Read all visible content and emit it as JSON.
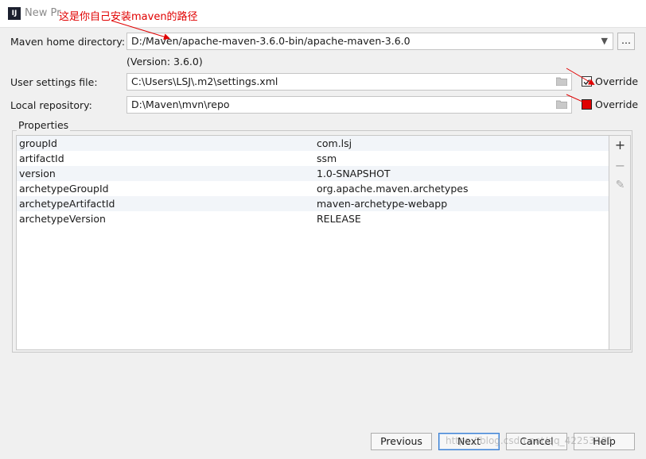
{
  "window": {
    "title": "New Pr",
    "app_icon": "IJ"
  },
  "annotation": "这是你自己安装maven的路径",
  "maven_home": {
    "label": "Maven home directory:",
    "value": "D:/Maven/apache-maven-3.6.0-bin/apache-maven-3.6.0",
    "browse_label": "...",
    "version": "(Version: 3.6.0)"
  },
  "user_settings": {
    "label": "User settings file:",
    "value": "C:\\Users\\LSJ\\.m2\\settings.xml",
    "override_label": "Override"
  },
  "local_repo": {
    "label": "Local repository:",
    "value": "D:\\Maven\\mvn\\repo",
    "override_label": "Override"
  },
  "properties": {
    "legend": "Properties",
    "rows": [
      {
        "key": "groupId",
        "value": "com.lsj"
      },
      {
        "key": "artifactId",
        "value": "ssm"
      },
      {
        "key": "version",
        "value": "1.0-SNAPSHOT"
      },
      {
        "key": "archetypeGroupId",
        "value": "org.apache.maven.archetypes"
      },
      {
        "key": "archetypeArtifactId",
        "value": "maven-archetype-webapp"
      },
      {
        "key": "archetypeVersion",
        "value": "RELEASE"
      }
    ],
    "tools": {
      "add": "+",
      "remove": "−",
      "edit": "✎"
    }
  },
  "buttons": {
    "previous": "Previous",
    "next": "Next",
    "cancel": "Cancel",
    "help": "Help"
  },
  "watermark": "https://blog.csdn.net/qq_42253301",
  "colors": {
    "annotation": "#e00000",
    "default_button_border": "#3c7fd1"
  }
}
